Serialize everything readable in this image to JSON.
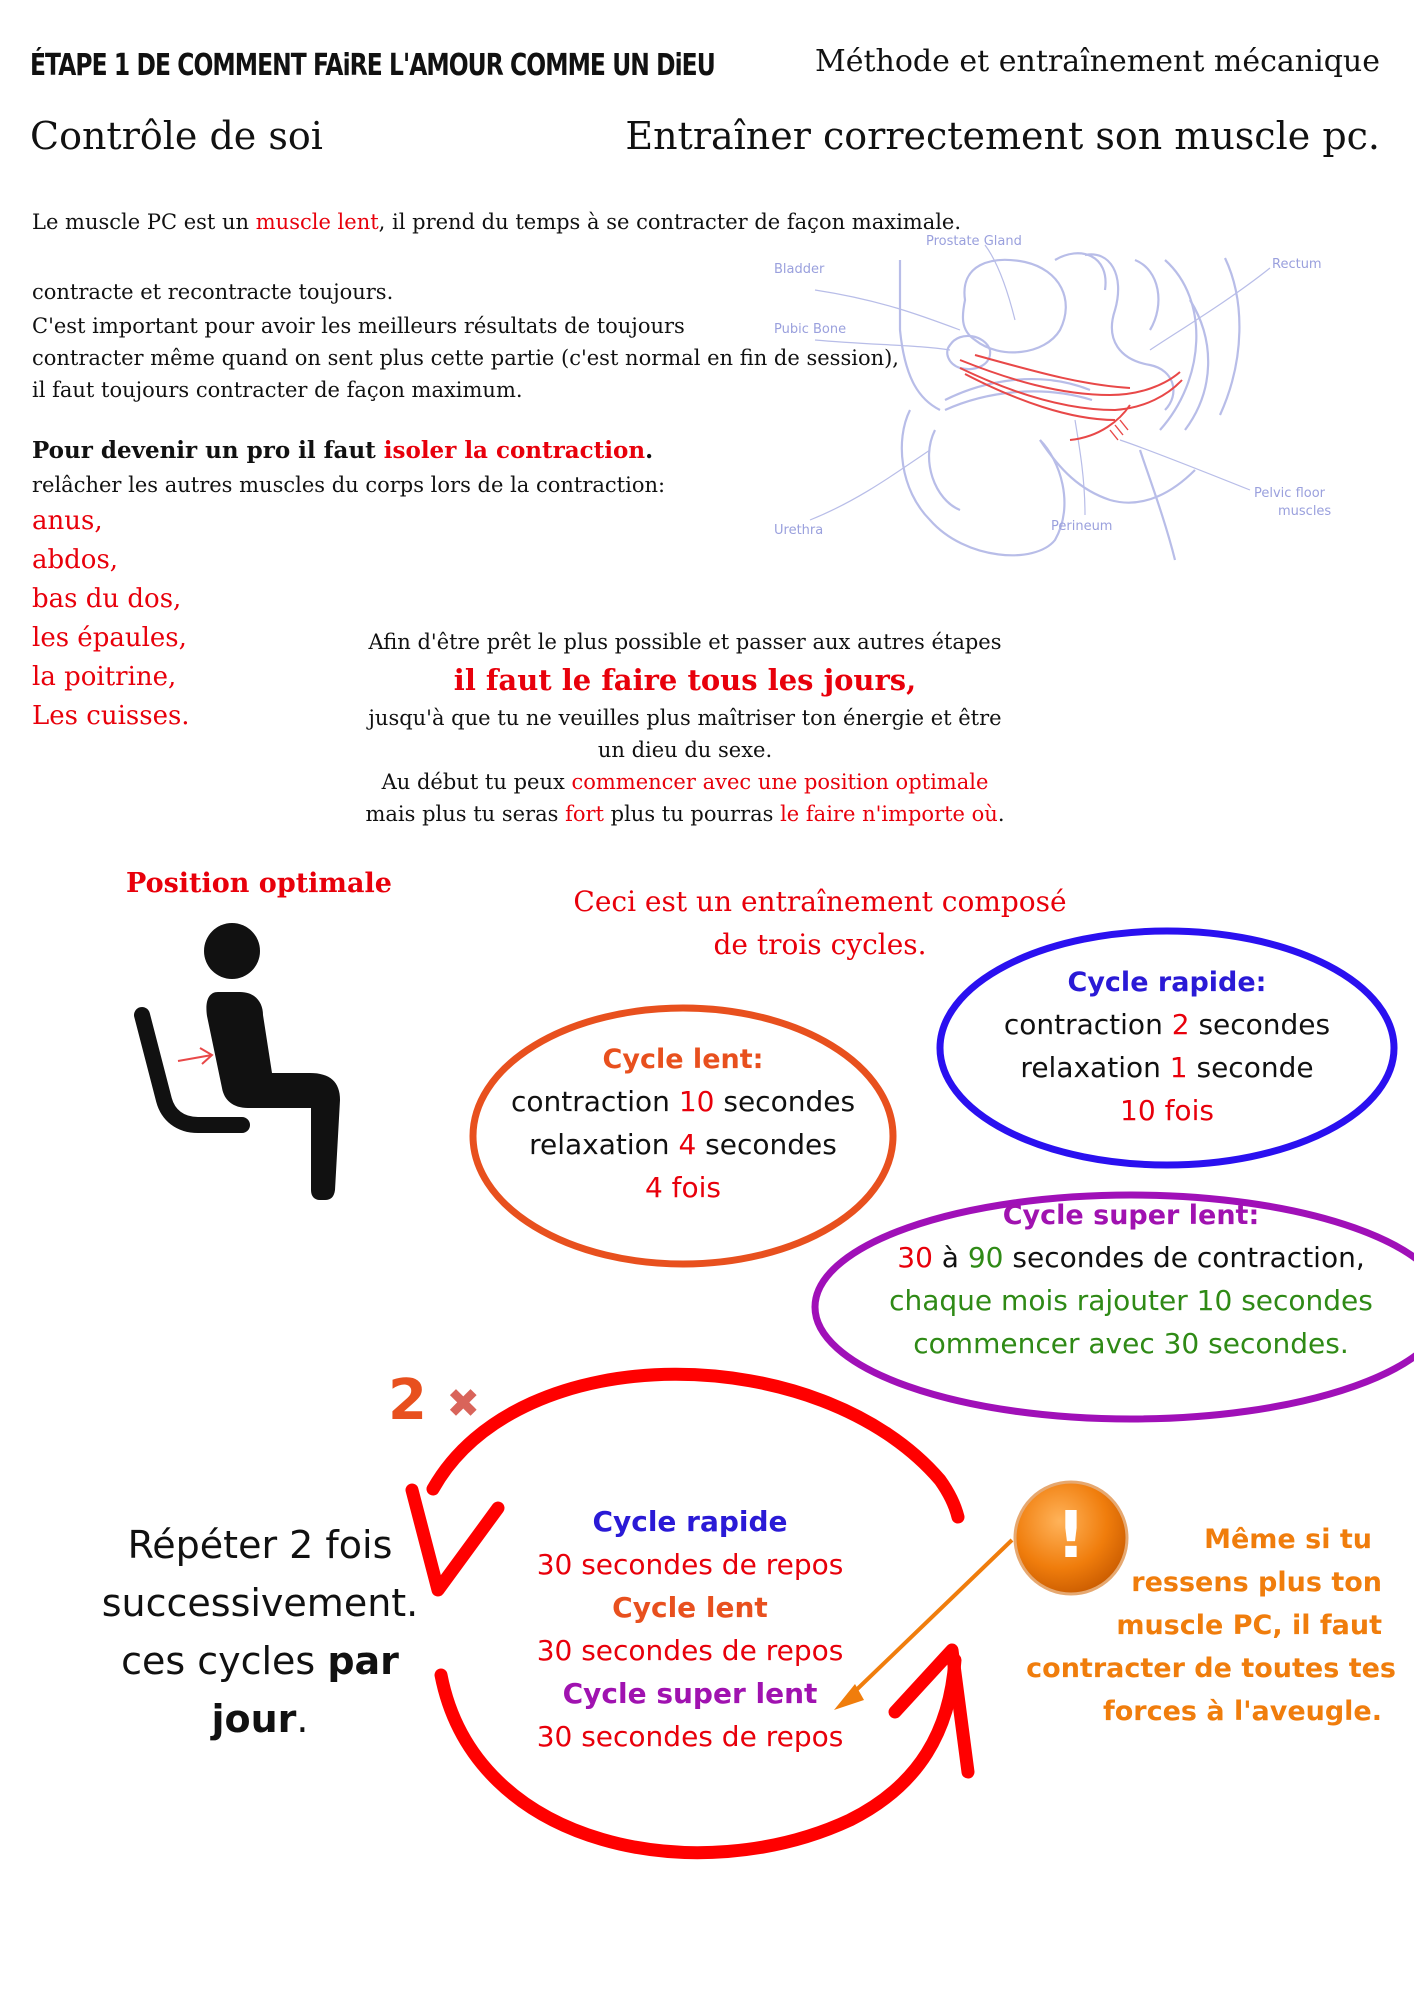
{
  "header": {
    "title": "ÉTAPE 1 DE COMMENT FAiRE L'AMOUR COMME UN DiEU",
    "subtitle": "Méthode et entraînement mécanique",
    "section_left": "Contrôle de soi",
    "section_right": "Entraîner correctement son muscle pc."
  },
  "intro": {
    "l1a": "Le muscle PC est un ",
    "l1b": "muscle lent",
    "l1c": ", il prend du temps à se contracter de façon maximale.",
    "l2": "contracte et recontracte toujours.",
    "l3": "C'est important pour avoir les meilleurs résultats de toujours",
    "l4": "contracter même quand on sent plus cette partie (c'est normal en fin de session),",
    "l5": "il faut toujours contracter de façon maximum."
  },
  "isolation": {
    "heading_a": "Pour devenir un pro il faut ",
    "heading_b": "isoler la contraction",
    "heading_c": ".",
    "sub": " relâcher les autres muscles du corps lors de la contraction:",
    "muscles": [
      "anus,",
      "abdos,",
      "bas du dos,",
      "les épaules,",
      "la poitrine,",
      "Les cuisses."
    ]
  },
  "anatomy": {
    "labels": {
      "prostate": "Prostate Gland",
      "bladder": "Bladder",
      "rectum": "Rectum",
      "pubic": "Pubic Bone",
      "pelvic1": "Pelvic floor",
      "pelvic2": "muscles",
      "urethra": "Urethra",
      "perineum": "Perineum"
    }
  },
  "advice": {
    "l1": "Afin d'être prêt le plus possible et passer aux autres étapes",
    "l2": "il faut le faire tous les jours,",
    "l3": "jusqu'à que tu ne veuilles plus maîtriser ton énergie et être",
    "l4": "un dieu du sexe.",
    "l5a": "Au début tu peux ",
    "l5b": "commencer avec une position optimale",
    "l6a": "mais plus tu seras ",
    "l6b": "fort",
    "l6c": " plus tu pourras ",
    "l6d": "le faire n'importe où",
    "l6e": "."
  },
  "position": {
    "title": "Position optimale"
  },
  "training": {
    "l1": "Ceci est un entraînement composé",
    "l2": "de trois cycles."
  },
  "cycle_rapide": {
    "title": "Cycle rapide:",
    "c1": "contraction ",
    "c2": "2",
    "c3": " secondes",
    "r1": "relaxation ",
    "r2": "1",
    "r3": " seconde",
    "times": "10 fois"
  },
  "cycle_lent": {
    "title": "Cycle lent:",
    "c1": "contraction ",
    "c2": "10",
    "c3": " secondes",
    "r1": "relaxation ",
    "r2": "4",
    "r3": " secondes",
    "times": "4 fois"
  },
  "cycle_super": {
    "title": "Cycle super lent:",
    "a1": "30",
    "a2": " à ",
    "a3": "90",
    "a4": " secondes de contraction,",
    "b": "chaque mois rajouter 10 secondes",
    "c": "commencer avec 30 secondes."
  },
  "repeat": {
    "multiplier": "2",
    "times_symbol": "✖",
    "l1": "Répéter 2  fois",
    "l2": "successivement.",
    "l3a": "ces cycles ",
    "l3b": "par",
    "l4a": "jour",
    "l4b": "."
  },
  "sequence": {
    "s1": "Cycle rapide",
    "s2": "30 secondes de repos",
    "s3": "Cycle lent",
    "s4": "30 secondes de repos",
    "s5": "Cycle super lent",
    "s6": "30 secondes de repos"
  },
  "warning": {
    "icon": "!",
    "l1": "Même si tu",
    "l2": "ressens plus ton",
    "l3": "muscle PC, il faut",
    "l4": "contracter de toutes tes",
    "l5": "forces à l'aveugle."
  },
  "colors": {
    "red": "#e8000b",
    "orange": "#f07d0c",
    "purple": "#a012b0",
    "blue": "#2a1ad6",
    "green": "#2f8a16",
    "ellipse_lent": "#e8501e",
    "ellipse_rapide": "#2a10f0",
    "ellipse_super": "#a010b8"
  }
}
